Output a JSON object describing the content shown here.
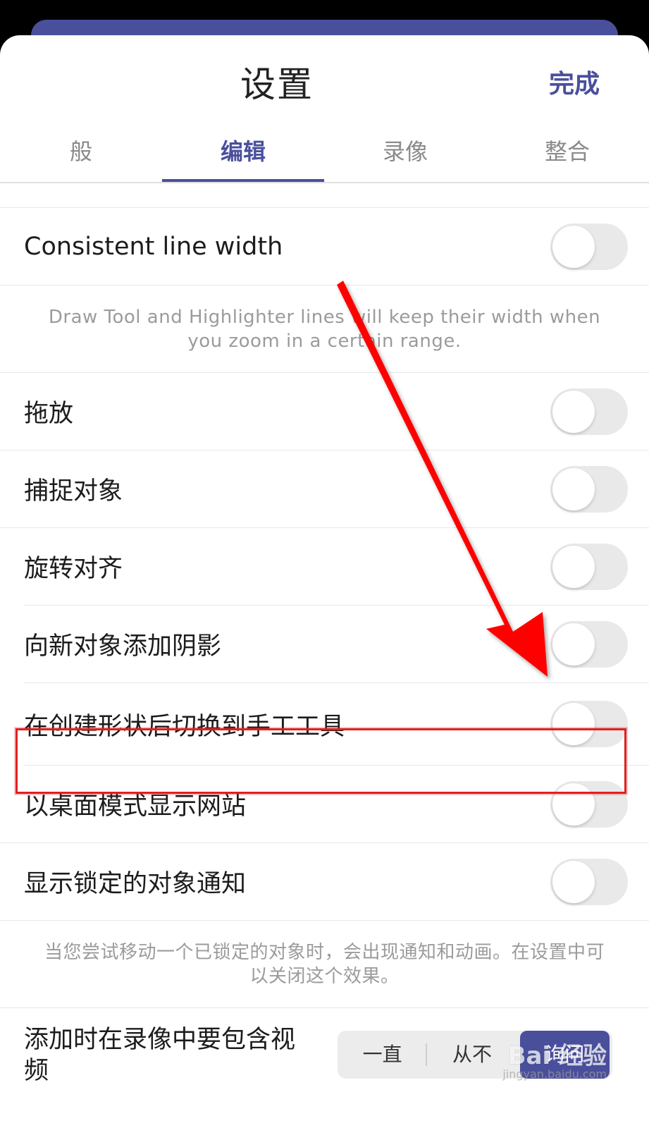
{
  "header": {
    "title": "设置",
    "done_label": "完成"
  },
  "tabs": [
    {
      "label": "般",
      "active": false
    },
    {
      "label": "编辑",
      "active": true
    },
    {
      "label": "录像",
      "active": false
    },
    {
      "label": "整合",
      "active": false
    }
  ],
  "settings": {
    "consistent_line_width": {
      "label": "Consistent line width",
      "enabled": false
    },
    "consistent_line_width_note": "Draw Tool and Highlighter lines will keep their width when you zoom in a certain range.",
    "drag_drop": {
      "label": "拖放",
      "enabled": false
    },
    "snap_objects": {
      "label": "捕捉对象",
      "enabled": false
    },
    "rotate_align": {
      "label": "旋转对齐",
      "enabled": false
    },
    "add_shadow": {
      "label": "向新对象添加阴影",
      "enabled": false
    },
    "switch_to_hand": {
      "label": "在创建形状后切换到手工工具",
      "enabled": false
    },
    "desktop_mode": {
      "label": "以桌面模式显示网站",
      "enabled": false
    },
    "locked_notice": {
      "label": "显示锁定的对象通知",
      "enabled": false
    },
    "locked_notice_note": "当您尝试移动一个已锁定的对象时，会出现通知和动画。在设置中可以关闭这个效果。",
    "include_video": {
      "label": "添加时在录像中要包含视频",
      "options": [
        "一直",
        "从不",
        "询问"
      ],
      "selected": "询问"
    }
  },
  "annotations": {
    "highlight_color": "#e02020",
    "arrow_color": "#ff0000"
  },
  "watermark": {
    "text": "Bai 经验",
    "url": "jingyan.baidu.com"
  }
}
